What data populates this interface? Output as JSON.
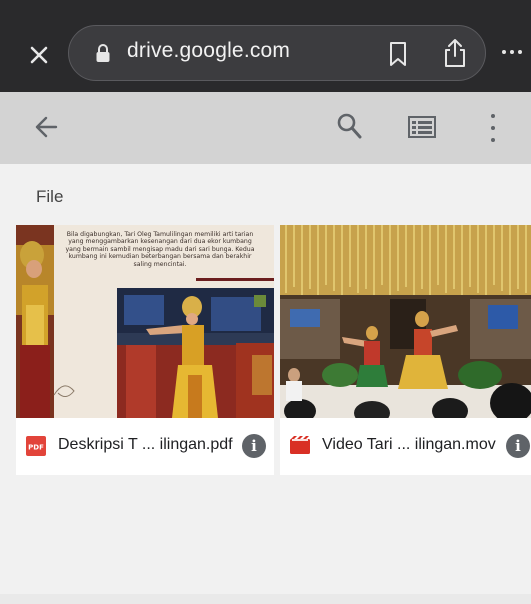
{
  "browser": {
    "url": "drive.google.com",
    "icons": {
      "close": "close-icon",
      "lock": "lock-icon",
      "bookmark": "bookmark-icon",
      "share": "share-icon",
      "more": "more-horizontal-icon"
    }
  },
  "toolbar": {
    "icons": {
      "back": "arrow-left-icon",
      "search": "search-icon",
      "list_view": "list-view-icon",
      "menu": "more-vertical-icon"
    }
  },
  "section": {
    "label": "File"
  },
  "files": [
    {
      "name": "Deskripsi T ... ilingan.pdf",
      "type_icon": "pdf-icon",
      "type_badge": "PDF",
      "thumbnail_caption": "Bila digabungkan, Tari Oleg Tamulilingan memiliki arti tarian yang menggambarkan kesenangan dari dua ekor kumbang yang bermain sambil mengisap madu dari sari bunga. Kedua kumbang ini kemudian beterbangan bersama dan berakhir saling mencintai."
    },
    {
      "name": "Video Tari ... ilingan.mov",
      "type_icon": "video-icon"
    }
  ],
  "colors": {
    "browser_bg": "#2a2a2c",
    "toolbar_bg": "#d3d3d3",
    "page_bg": "#f1f1f1",
    "pdf_red": "#e2443a",
    "video_red": "#d93025",
    "icon_grey": "#5f6368"
  }
}
